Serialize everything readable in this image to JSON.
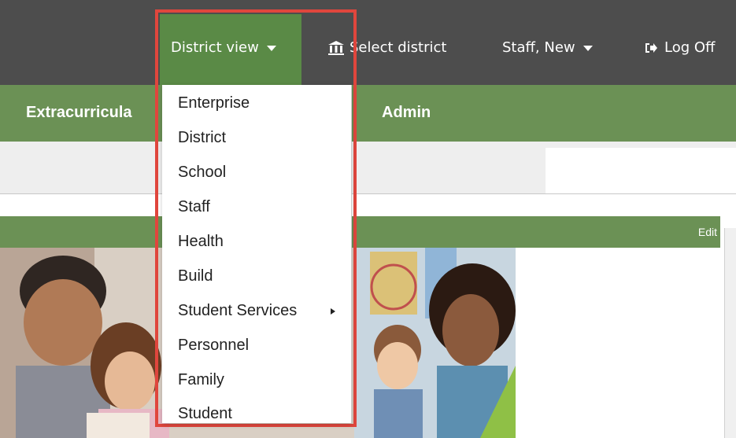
{
  "header": {
    "district_view_label": "District view",
    "select_district_label": "Select district",
    "user_label": "Staff, New",
    "logoff_label": "Log Off"
  },
  "nav": {
    "items": [
      "Extracurricula",
      "Admin"
    ]
  },
  "panel": {
    "edit_label": "Edit"
  },
  "dropdown": {
    "items": [
      {
        "label": "Enterprise"
      },
      {
        "label": "District"
      },
      {
        "label": "School"
      },
      {
        "label": "Staff"
      },
      {
        "label": "Health"
      },
      {
        "label": "Build"
      },
      {
        "label": "Student Services",
        "has_submenu": true
      },
      {
        "label": "Personnel"
      },
      {
        "label": "Family"
      },
      {
        "label": "Student"
      }
    ]
  },
  "colors": {
    "top_bar": "#4d4d4d",
    "active_green": "#5a8a46",
    "nav_green": "#6b9155",
    "highlight_red": "#e0463d"
  },
  "icons": {
    "select_district": "bank-building-icon",
    "logoff": "logout-arrow-icon"
  }
}
